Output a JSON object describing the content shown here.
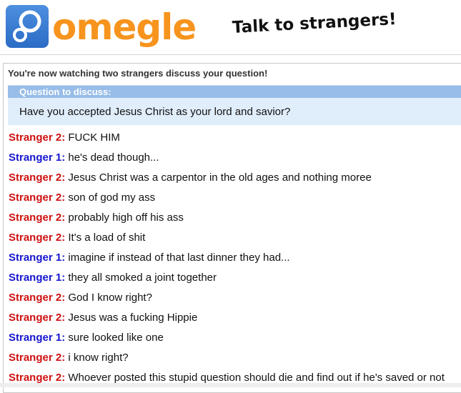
{
  "header": {
    "logo_text": "omegle",
    "tagline": "Talk to strangers!"
  },
  "chat": {
    "status": "You're now watching two strangers discuss your question!",
    "question_title": "Question to discuss:",
    "question_text": "Have you accepted Jesus Christ as your lord and savior?",
    "messages": [
      {
        "speaker": "Stranger 2:",
        "text": "FUCK HIM"
      },
      {
        "speaker": "Stranger 1:",
        "text": "he's dead though..."
      },
      {
        "speaker": "Stranger 2:",
        "text": "Jesus Christ was a carpentor in the old ages and nothing moree"
      },
      {
        "speaker": "Stranger 2:",
        "text": "son of god my ass"
      },
      {
        "speaker": "Stranger 2:",
        "text": "probably high off his ass"
      },
      {
        "speaker": "Stranger 2:",
        "text": "It's a load of shit"
      },
      {
        "speaker": "Stranger 1:",
        "text": "imagine if instead of that last dinner they had..."
      },
      {
        "speaker": "Stranger 1:",
        "text": "they all smoked a joint together"
      },
      {
        "speaker": "Stranger 2:",
        "text": "God I know right?"
      },
      {
        "speaker": "Stranger 2:",
        "text": "Jesus was a fucking Hippie"
      },
      {
        "speaker": "Stranger 1:",
        "text": "sure looked like one"
      },
      {
        "speaker": "Stranger 2:",
        "text": "i know right?"
      },
      {
        "speaker": "Stranger 2:",
        "text": "Whoever posted this stupid question should die and find out if he's saved or not"
      }
    ]
  },
  "colors": {
    "logo_orange": "#f7941d",
    "logo_blue": "#2b6cc6",
    "stranger1": "#1515d0",
    "stranger2": "#d01010",
    "question_header": "#97bde8",
    "question_body": "#e0edfb"
  },
  "icons": {
    "logo": "omegle-logo-icon"
  }
}
